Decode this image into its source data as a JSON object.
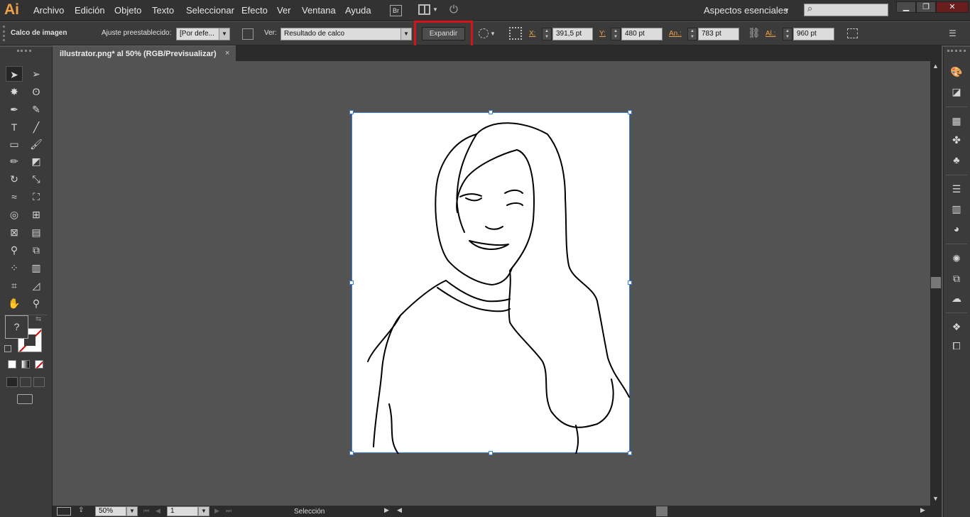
{
  "app": {
    "logo_text": "Ai"
  },
  "menu": [
    "Archivo",
    "Edición",
    "Objeto",
    "Texto",
    "Seleccionar",
    "Efecto",
    "Ver",
    "Ventana",
    "Ayuda"
  ],
  "bridge_label": "Br",
  "workspace": {
    "label": "Aspectos esenciales"
  },
  "control_bar": {
    "panel_label": "Calco de imagen",
    "preset_label": "Ajuste preestablecido:",
    "preset_value": "[Por defe...",
    "view_label": "Ver:",
    "view_value": "Resultado de calco",
    "expand_label": "Expandir",
    "x_label": "X:",
    "x_value": "391,5 pt",
    "y_label": "Y:",
    "y_value": "480 pt",
    "w_label": "An.:",
    "w_value": "783 pt",
    "h_label": "Al.:",
    "h_value": "960 pt"
  },
  "document": {
    "tab_title": "illustrator.png* al 50% (RGB/Previsualizar)",
    "close_glyph": "×"
  },
  "toolbox": {
    "fill_glyph": "?"
  },
  "status": {
    "zoom": "50%",
    "page": "1",
    "tool_name": "Selección"
  },
  "colors": {
    "accent": "#f0a24a",
    "highlight": "#d8121b",
    "selection": "#3a7bd5"
  }
}
